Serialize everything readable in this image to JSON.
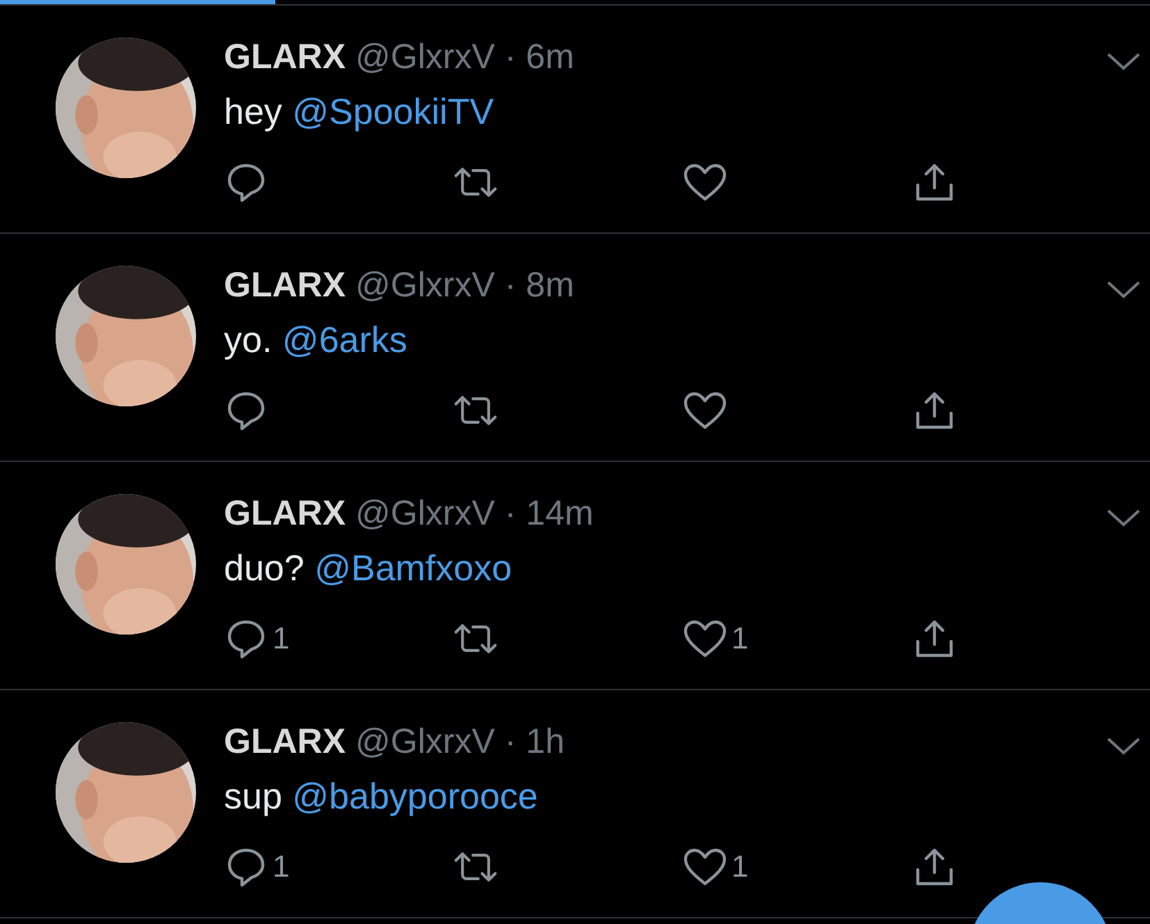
{
  "top_progress": {
    "level": 0.24
  },
  "tweets": [
    {
      "name": "GLARX",
      "handle": "@GlxrxV",
      "time": "· 6m",
      "text": "hey",
      "mention": "@SpookiiTV"
    },
    {
      "name": "GLARX",
      "handle": "@GlxrxV",
      "time": "· 8m",
      "text": "yo.",
      "mention": "@6arks"
    },
    {
      "name": "GLARX",
      "handle": "@GlxrxV",
      "time": "· 14m",
      "text": "duo?",
      "mention": "@Bamfxoxo",
      "replies": "1",
      "likes": "1"
    },
    {
      "name": "GLARX",
      "handle": "@GlxrxV",
      "time": "· 1h",
      "text": "sup",
      "mention": "@babyporooce",
      "replies": "1",
      "likes": "1"
    }
  ]
}
